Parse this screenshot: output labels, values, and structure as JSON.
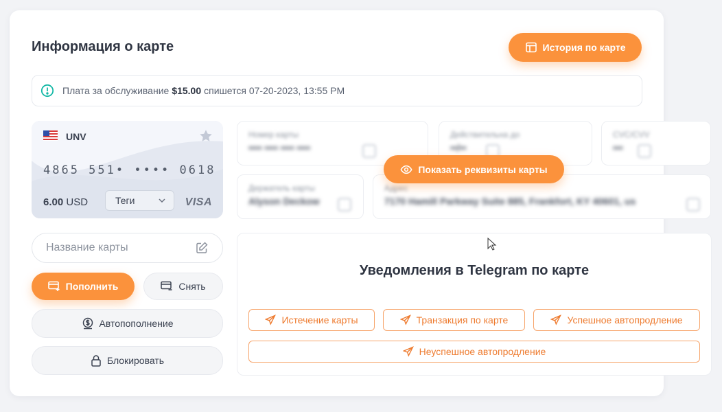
{
  "title": "Информация о карте",
  "history_button": "История по карте",
  "fee": {
    "prefix": "Плата за обслуживание",
    "amount": "$15.00",
    "suffix": "спишется 07-20-2023, 13:55 PM"
  },
  "card": {
    "bank": "UNV",
    "number": "4865 551• •••• 0618",
    "balance_amount": "6.00",
    "currency": "USD",
    "tags_label": "Теги",
    "brand": "VISA"
  },
  "hidden_fields": {
    "number_label": "Номер карты",
    "number_value": "•••• •••• •••• ••••",
    "expiry_label": "Действительна до",
    "expiry_value": "••/••",
    "cvv_label": "CVC/CVV",
    "cvv_value": "•••",
    "holder_label": "Держатель карты",
    "holder_value": "Alyson Deckow",
    "address_label": "Адрес",
    "address_value": "7170 Hamill Parkway Suite 885, Frankfort, KY 40601, us"
  },
  "show_details_button": "Показать реквизиты карты",
  "card_name_placeholder": "Название карты",
  "actions": {
    "topup": "Пополнить",
    "withdraw": "Снять",
    "autotopup": "Автопополнение",
    "block": "Блокировать"
  },
  "telegram": {
    "title": "Уведомления в Telegram по карте",
    "buttons": [
      "Истечение карты",
      "Транзакция по карте",
      "Успешное автопродление",
      "Неуспешное автопродление"
    ]
  },
  "colors": {
    "accent": "#fb923c",
    "accent_text": "#ee7b2f",
    "info": "#14b8a6"
  }
}
